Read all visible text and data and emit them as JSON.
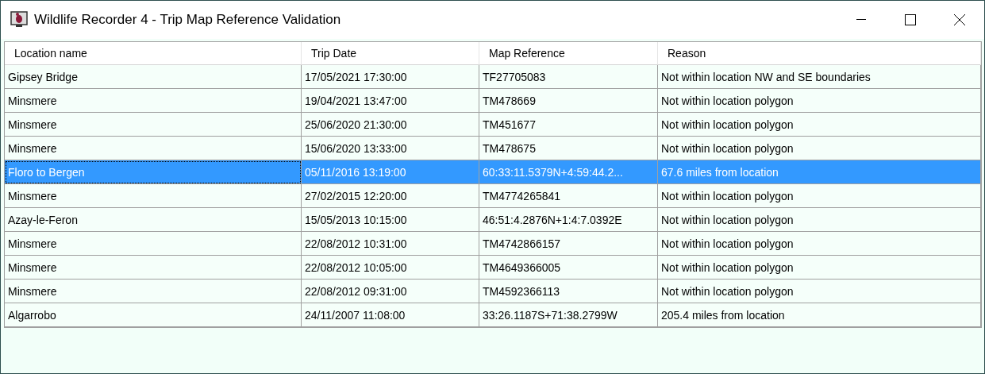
{
  "window": {
    "title": "Wildlife Recorder 4 - Trip Map Reference Validation"
  },
  "table": {
    "columns": [
      "Location name",
      "Trip Date",
      "Map Reference",
      "Reason"
    ],
    "rows": [
      {
        "cells": [
          "Gipsey Bridge",
          "17/05/2021 17:30:00",
          "TF27705083",
          "Not within location NW and SE boundaries"
        ],
        "selected": false
      },
      {
        "cells": [
          "Minsmere",
          "19/04/2021 13:47:00",
          "TM478669",
          "Not within location polygon"
        ],
        "selected": false
      },
      {
        "cells": [
          "Minsmere",
          "25/06/2020 21:30:00",
          "TM451677",
          "Not within location polygon"
        ],
        "selected": false
      },
      {
        "cells": [
          "Minsmere",
          "15/06/2020 13:33:00",
          "TM478675",
          "Not within location polygon"
        ],
        "selected": false
      },
      {
        "cells": [
          "Floro to Bergen",
          "05/11/2016 13:19:00",
          "60:33:11.5379N+4:59:44.2...",
          "67.6 miles from location"
        ],
        "selected": true
      },
      {
        "cells": [
          "Minsmere",
          "27/02/2015 12:20:00",
          "TM4774265841",
          "Not within location polygon"
        ],
        "selected": false
      },
      {
        "cells": [
          "Azay-le-Feron",
          "15/05/2013 10:15:00",
          "46:51:4.2876N+1:4:7.0392E",
          "Not within location polygon"
        ],
        "selected": false
      },
      {
        "cells": [
          "Minsmere",
          "22/08/2012 10:31:00",
          "TM4742866157",
          "Not within location polygon"
        ],
        "selected": false
      },
      {
        "cells": [
          "Minsmere",
          "22/08/2012 10:05:00",
          "TM4649366005",
          "Not within location polygon"
        ],
        "selected": false
      },
      {
        "cells": [
          "Minsmere",
          "22/08/2012 09:31:00",
          "TM4592366113",
          "Not within location polygon"
        ],
        "selected": false
      },
      {
        "cells": [
          "Algarrobo",
          "24/11/2007 11:08:00",
          "33:26.1187S+71:38.2799W",
          "205.4 miles from location"
        ],
        "selected": false
      }
    ]
  }
}
